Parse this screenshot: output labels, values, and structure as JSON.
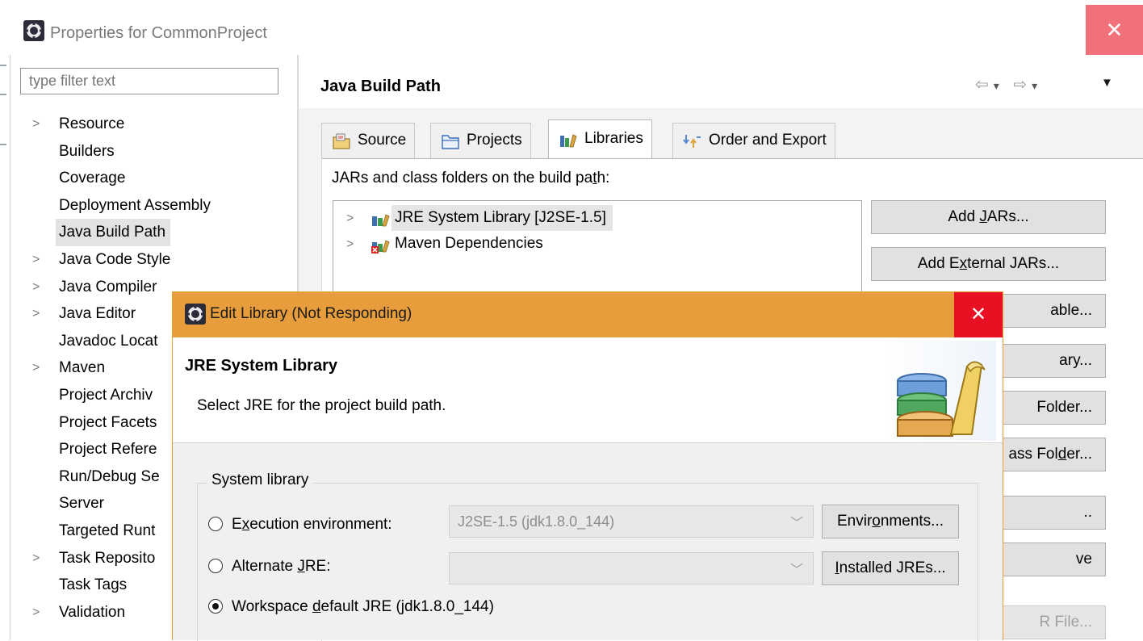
{
  "window": {
    "title": "Properties for CommonProject",
    "close_glyph": "✕",
    "icon": "eclipse-gear-icon"
  },
  "sidebar": {
    "filter_placeholder": "type filter text",
    "items": [
      {
        "label": "Resource",
        "expandable": true
      },
      {
        "label": "Builders",
        "expandable": false
      },
      {
        "label": "Coverage",
        "expandable": false
      },
      {
        "label": "Deployment Assembly",
        "expandable": false
      },
      {
        "label": "Java Build Path",
        "expandable": false,
        "selected": true
      },
      {
        "label": "Java Code Style",
        "expandable": true
      },
      {
        "label": "Java Compiler",
        "expandable": true
      },
      {
        "label": "Java Editor",
        "expandable": true
      },
      {
        "label": "Javadoc Locat",
        "expandable": false
      },
      {
        "label": "Maven",
        "expandable": true
      },
      {
        "label": "Project Archiv",
        "expandable": false
      },
      {
        "label": "Project Facets",
        "expandable": false
      },
      {
        "label": "Project Refere",
        "expandable": false
      },
      {
        "label": "Run/Debug Se",
        "expandable": false
      },
      {
        "label": "Server",
        "expandable": false
      },
      {
        "label": "Targeted Runt",
        "expandable": false
      },
      {
        "label": "Task Reposito",
        "expandable": true
      },
      {
        "label": "Task Tags",
        "expandable": false
      },
      {
        "label": "Validation",
        "expandable": true
      }
    ]
  },
  "page": {
    "title": "Java Build Path",
    "nav_back": "⇦",
    "nav_forward": "⇨",
    "nav_dropdown": "▾",
    "menu_glyph": "▼",
    "tabs": [
      {
        "label": "Source",
        "icon": "source-folder-icon"
      },
      {
        "label": "Projects",
        "icon": "projects-folder-icon"
      },
      {
        "label": "Libraries",
        "icon": "libraries-icon",
        "active": true
      },
      {
        "label": "Order and Export",
        "icon": "order-export-icon"
      }
    ],
    "jars_label": "JARs and class folders on the build path:",
    "entries": [
      {
        "label": "JRE System Library [J2SE-1.5]",
        "icon": "library-icon",
        "selected": true
      },
      {
        "label": "Maven Dependencies",
        "icon": "library-error-icon"
      }
    ],
    "buttons": {
      "add_jars": "Add JARs...",
      "add_external_jars": "Add External JARs...",
      "add_variable": "able...",
      "add_library": "ary...",
      "add_class_folder": "Folder...",
      "add_external_class_folder": "ass Folder...",
      "edit": "..",
      "remove": "ve",
      "migrate_jar": "R File..."
    }
  },
  "dialog": {
    "title": "Edit Library (Not Responding)",
    "close_glyph": "✕",
    "header_title": "JRE System Library",
    "header_desc": "Select JRE for the project build path.",
    "group_label": "System library",
    "options": {
      "execution_env": {
        "label": "Execution environment:",
        "selected": false
      },
      "alternate_jre": {
        "label": "Alternate JRE:",
        "selected": false
      },
      "workspace_default": {
        "label": "Workspace default JRE (jdk1.8.0_144)",
        "selected": true
      }
    },
    "execution_env_value": "J2SE-1.5 (jdk1.8.0_144)",
    "alternate_jre_value": "",
    "combo_arrow": "﹀",
    "environments_button": "Environments...",
    "installed_jres_button": "Installed JREs..."
  }
}
